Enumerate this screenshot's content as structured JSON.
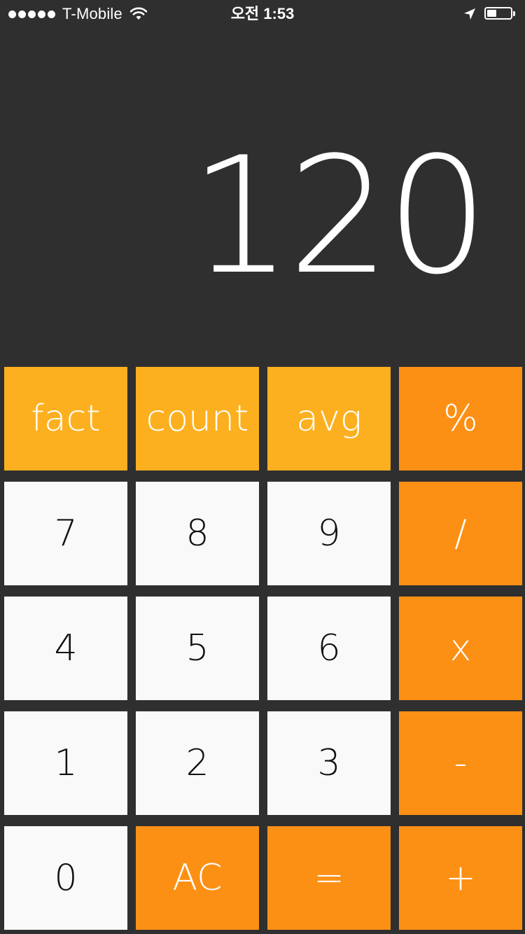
{
  "status_bar": {
    "carrier": "T-Mobile",
    "time": "오전 1:53",
    "signal_bars": 5,
    "battery_level": 0.4,
    "icons": [
      "signal-dots-icon",
      "wifi-icon",
      "location-arrow-icon",
      "battery-icon"
    ]
  },
  "display": {
    "value": "120"
  },
  "colors": {
    "background": "#2f2f2f",
    "function_key": "#fdb01f",
    "operator_key": "#fc9015",
    "number_key": "#f9f9f9",
    "number_text": "#111111",
    "light_text": "#ffffff"
  },
  "keypad": {
    "row1": {
      "k1": "fact",
      "k2": "count",
      "k3": "avg",
      "k4": "%"
    },
    "row2": {
      "k1": "7",
      "k2": "8",
      "k3": "9",
      "k4": "/"
    },
    "row3": {
      "k1": "4",
      "k2": "5",
      "k3": "6",
      "k4": "x"
    },
    "row4": {
      "k1": "1",
      "k2": "2",
      "k3": "3",
      "k4": "-"
    },
    "row5": {
      "k1": "0",
      "k2": "AC",
      "k3": "=",
      "k4": "+"
    }
  }
}
